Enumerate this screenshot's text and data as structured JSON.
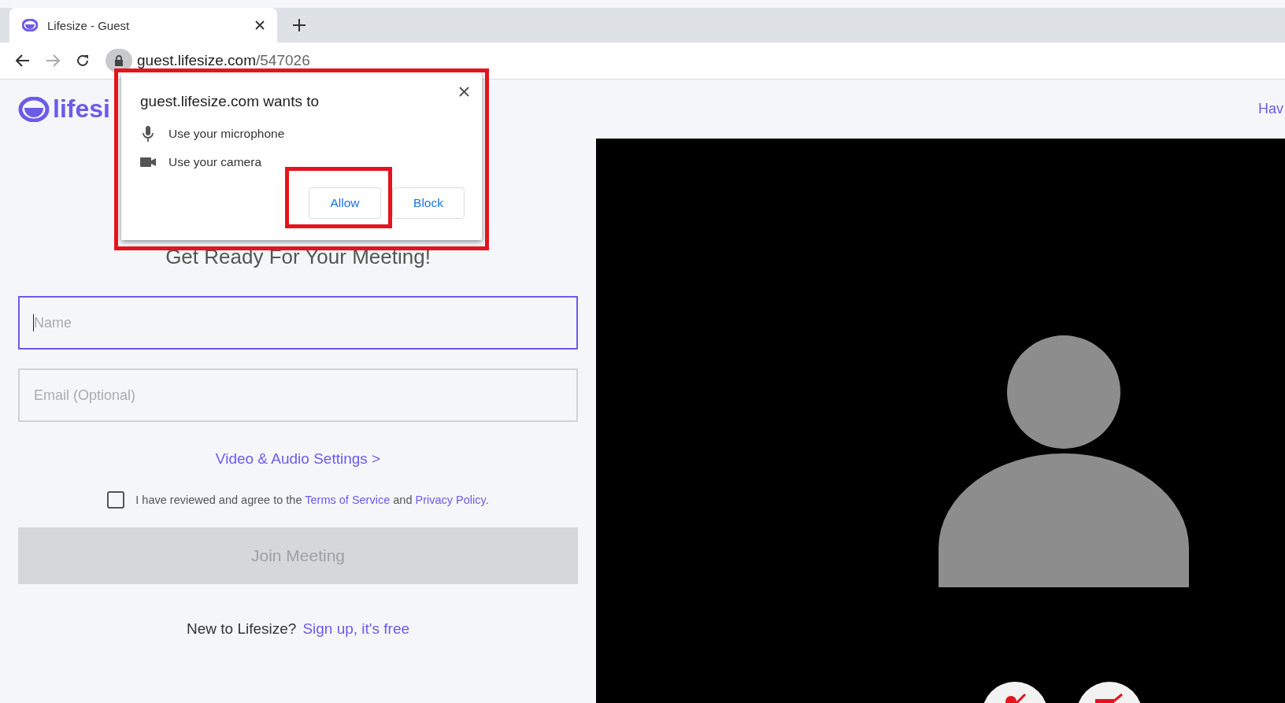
{
  "browser": {
    "tab": {
      "title": "Lifesize - Guest",
      "selected": true
    },
    "address": {
      "host": "guest.lifesize.com",
      "path": "/547026"
    }
  },
  "permission_popup": {
    "title": "guest.lifesize.com wants to",
    "permissions": [
      {
        "kind": "microphone",
        "label": "Use your microphone"
      },
      {
        "kind": "camera",
        "label": "Use your camera"
      }
    ],
    "buttons": [
      {
        "label": "Allow",
        "highlighted": true
      },
      {
        "label": "Block",
        "highlighted": false
      }
    ]
  },
  "header": {
    "logo": "lifesi",
    "right_link": "Hav"
  },
  "form": {
    "title": "Get Ready For Your Meeting!",
    "fields": [
      {
        "placeholder": "Name",
        "focused": true
      },
      {
        "placeholder": "Email (Optional)",
        "focused": false
      }
    ],
    "settings_link": "Video & Audio Settings >",
    "agreement": {
      "checked": false,
      "text_before": "I have reviewed and agree to the",
      "terms_link": "Terms of Service",
      "text_mid": "and",
      "privacy_link": "Privacy Policy",
      "text_after": "."
    },
    "join_button": {
      "label": "Join Meeting",
      "disabled": true
    },
    "signup": {
      "question": "New to Lifesize?",
      "link": "Sign up, it's free"
    }
  },
  "video_preview": {
    "controls": [
      {
        "kind": "microphone"
      },
      {
        "kind": "camera"
      }
    ]
  }
}
